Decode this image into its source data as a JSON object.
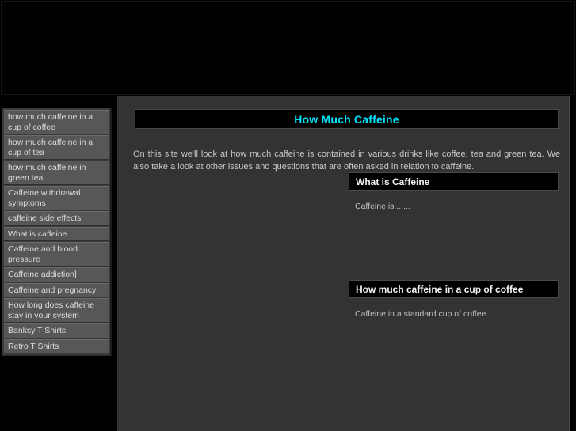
{
  "site": {
    "title": "How Much Caffeine",
    "title_color": "#00e5ff",
    "background_color": "#000000",
    "content_background_color": "#333333",
    "menu_item_color": "#575757"
  },
  "banner": {
    "alt": ""
  },
  "sidebar": {
    "items": [
      {
        "label": "how much caffeine in a cup of coffee"
      },
      {
        "label": "how much caffeine in a cup of tea"
      },
      {
        "label": "how much caffeine in green tea"
      },
      {
        "label": "Caffeine withdrawal symptoms"
      },
      {
        "label": "caffeine side effects"
      },
      {
        "label": "What is caffeine"
      },
      {
        "label": "Caffeine and blood pressure"
      },
      {
        "label": "Caffeine addiction]"
      },
      {
        "label": "Caffeine and pregnancy"
      },
      {
        "label": "How long does caffeine stay in your system"
      },
      {
        "label": "Banksy T Shirts"
      },
      {
        "label": "Retro T Shirts"
      }
    ]
  },
  "main": {
    "intro": "On this site we'll look at how much caffeine is contained in various drinks like coffee, tea and green tea. We also take a look at other issues and questions that are often asked in relation to caffeine.",
    "sections": [
      {
        "heading": "What is Caffeine",
        "body": "Caffeine is......."
      },
      {
        "heading": "How much caffeine in a cup of coffee",
        "body": "Caffeine in a standard cup of coffee...."
      }
    ]
  }
}
